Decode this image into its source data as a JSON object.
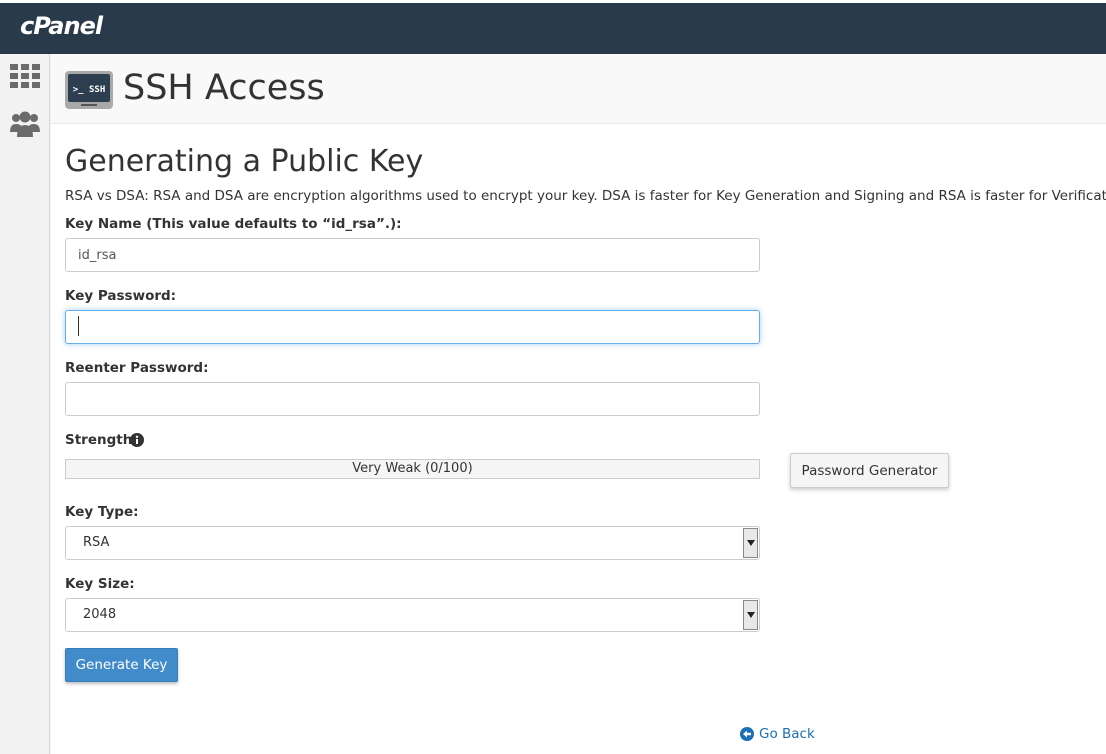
{
  "brand": {
    "logo_text": "cPanel"
  },
  "sidebar": {
    "items": [
      {
        "icon": "apps-grid-icon"
      },
      {
        "icon": "users-icon"
      }
    ]
  },
  "header": {
    "icon_text": ">_ SSH",
    "title": "SSH Access"
  },
  "form": {
    "section_title": "Generating a Public Key",
    "description": "RSA vs DSA: RSA and DSA are encryption algorithms used to encrypt your key. DSA is faster for Key Generation and Signing and RSA is faster for Verification.",
    "key_name": {
      "label": "Key Name (This value defaults to “id_rsa”.):",
      "value": "id_rsa"
    },
    "key_password": {
      "label": "Key Password:",
      "value": ""
    },
    "reenter_password": {
      "label": "Reenter Password:",
      "value": ""
    },
    "strength": {
      "label": "Strength",
      "meter_text": "Very Weak (0/100)",
      "score": 0
    },
    "password_generator_label": "Password Generator",
    "key_type": {
      "label": "Key Type:",
      "selected": "RSA"
    },
    "key_size": {
      "label": "Key Size:",
      "selected": "2048"
    },
    "submit_label": "Generate Key"
  },
  "footer": {
    "go_back_label": "Go Back"
  },
  "colors": {
    "topbar": "#293a4a",
    "primary": "#428bca",
    "link": "#1a6fb5"
  }
}
